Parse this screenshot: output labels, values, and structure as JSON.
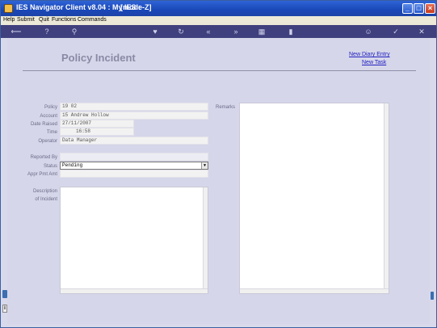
{
  "window": {
    "title": "IES Navigator Client v8.04 : My IES :",
    "mode": "[mode-Z]"
  },
  "menu": {
    "items": [
      "Help",
      "Submit",
      "Quit",
      "Functions",
      "Commands"
    ]
  },
  "toolbar": {
    "icons": [
      "back-icon",
      "help-icon",
      "search-icon",
      "heart-icon",
      "refresh-icon",
      "double-left-icon",
      "double-right-icon",
      "grid-icon",
      "document-icon",
      "user-icon",
      "check-icon",
      "close-icon"
    ]
  },
  "page": {
    "title": "Policy Incident",
    "links": {
      "new_diary_entry": "New Diary Entry",
      "new_task": "New Task"
    }
  },
  "form": {
    "policy_label": "Policy",
    "policy_value": "19 02",
    "account_label": "Account",
    "account_value": "15 Andrew Hollow",
    "date_raised_label": "Date Raised",
    "date_raised_value": "27/11/2007",
    "time_label": "Time",
    "time_value": "16:58",
    "operator_label": "Operator",
    "operator_value": "Data Manager",
    "reported_by_label": "Reported By",
    "reported_by_value": "",
    "status_label": "Status",
    "status_value": "Pending",
    "appr_pmt_amt_label": "Appr Pmt Amt",
    "appr_pmt_amt_value": "",
    "description_label_1": "Description",
    "description_label_2": "of Incident",
    "remarks_label": "Remarks"
  }
}
